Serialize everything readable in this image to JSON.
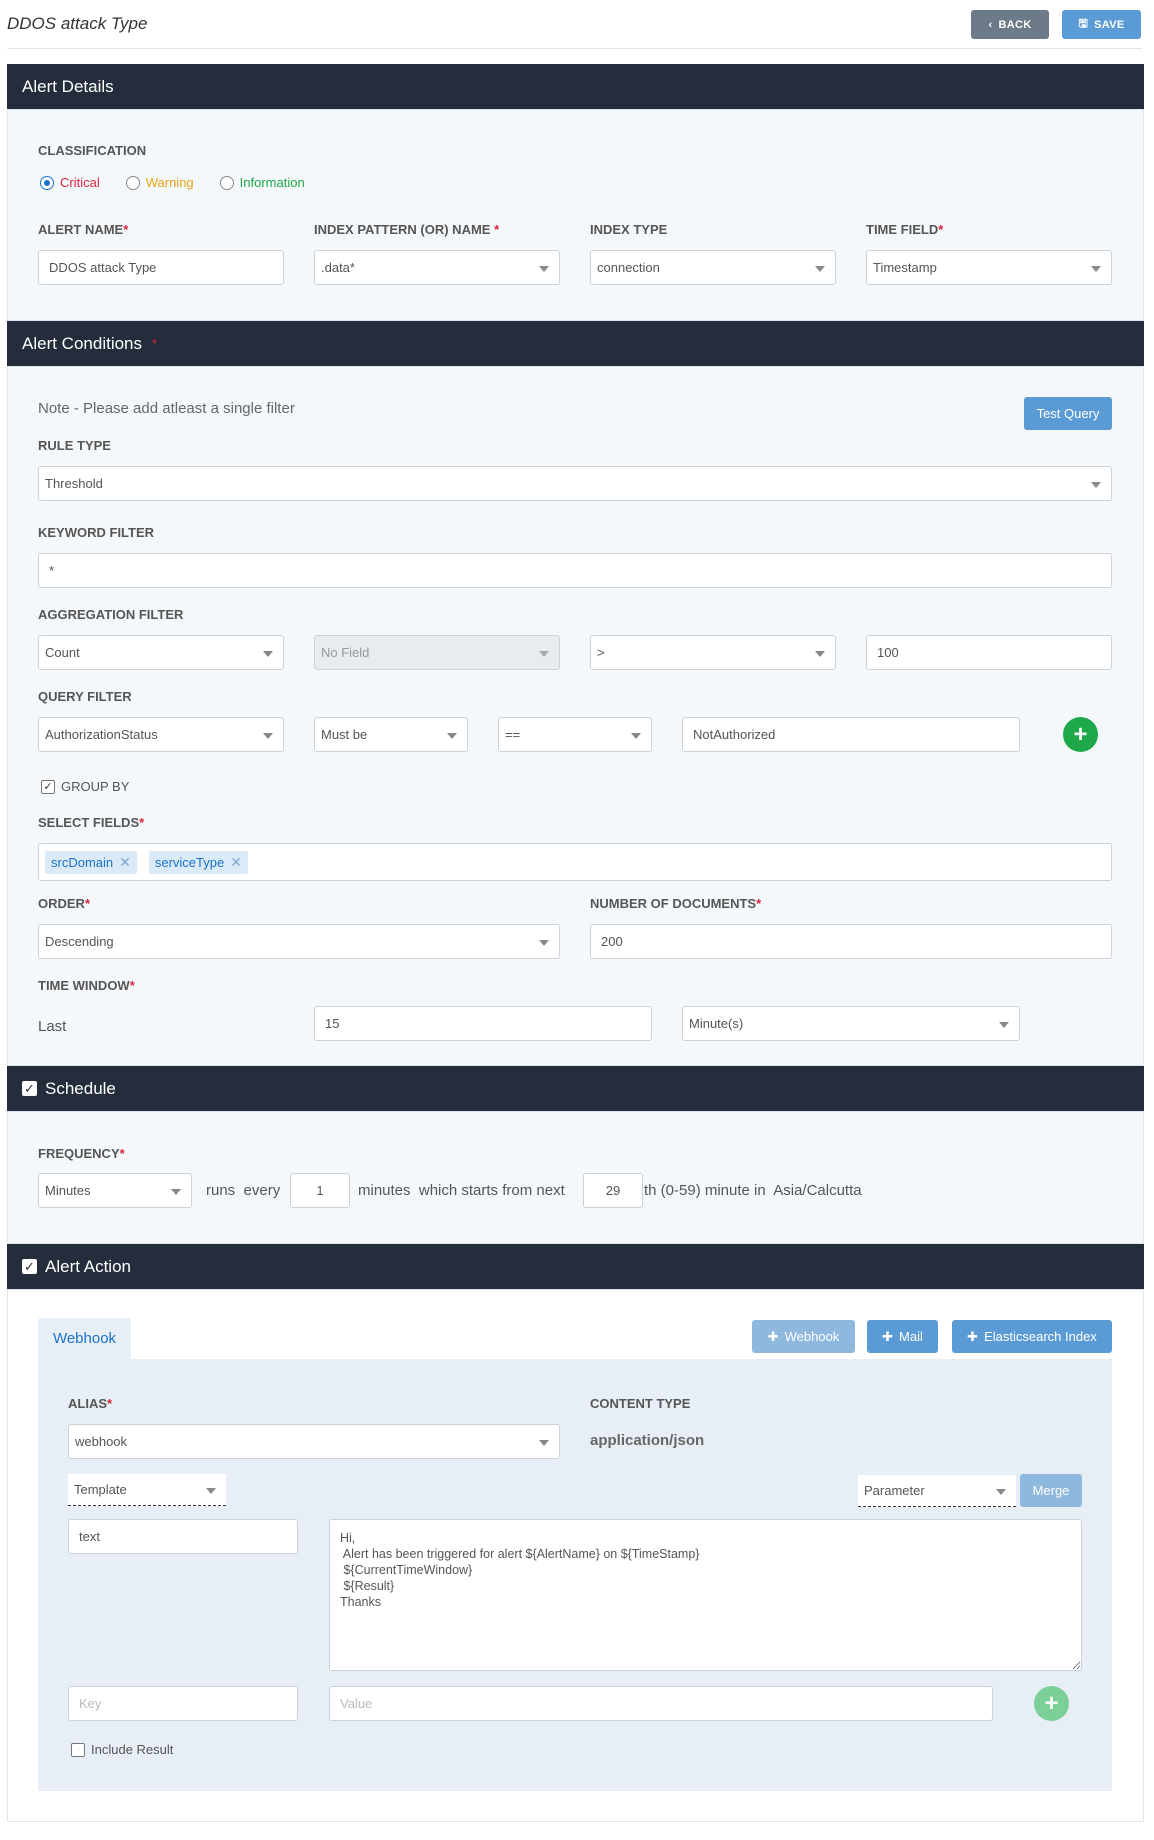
{
  "header": {
    "title": "DDOS attack Type",
    "back_label": "BACK",
    "save_label": "SAVE"
  },
  "alert_details": {
    "title": "Alert Details",
    "classification_label": "CLASSIFICATION",
    "classification_options": [
      {
        "label": "Critical",
        "color": "#d7263d",
        "selected": true
      },
      {
        "label": "Warning",
        "color": "#e8a317",
        "selected": false
      },
      {
        "label": "Information",
        "color": "#1fa84a",
        "selected": false
      }
    ],
    "alert_name_label": "ALERT NAME",
    "alert_name_value": "DDOS attack Type",
    "index_pattern_label": "INDEX PATTERN (OR) NAME",
    "index_pattern_value": ".data*",
    "index_type_label": "INDEX TYPE",
    "index_type_value": "connection",
    "time_field_label": "TIME FIELD",
    "time_field_value": "Timestamp"
  },
  "alert_conditions": {
    "title": "Alert Conditions",
    "note": "Note - Please add atleast a single filter",
    "test_query_label": "Test Query",
    "rule_type_label": "RULE TYPE",
    "rule_type_value": "Threshold",
    "keyword_filter_label": "KEYWORD FILTER",
    "keyword_filter_value": "*",
    "aggregation_filter_label": "AGGREGATION FILTER",
    "aggregation": {
      "function": "Count",
      "field": "No Field",
      "operator": ">",
      "value": "100"
    },
    "query_filter_label": "QUERY FILTER",
    "query_filter": {
      "field": "AuthorizationStatus",
      "condition": "Must be",
      "operator": "==",
      "value": "NotAuthorized"
    },
    "group_by_label": "GROUP BY",
    "select_fields_label": "SELECT FIELDS",
    "select_fields": [
      "srcDomain",
      "serviceType"
    ],
    "order_label": "ORDER",
    "order_value": "Descending",
    "num_docs_label": "NUMBER OF DOCUMENTS",
    "num_docs_value": "200",
    "time_window_label": "TIME WINDOW",
    "time_window_prefix": "Last",
    "time_window_value": "15",
    "time_window_unit": "Minute(s)"
  },
  "schedule": {
    "title": "Schedule",
    "frequency_label": "FREQUENCY",
    "frequency_value": "Minutes",
    "runs_every": "runs  every",
    "every_value": "1",
    "minutes_text": "minutes  which starts from next",
    "start_value": "29",
    "suffix_text": "th (0-59) minute in  Asia/Calcutta"
  },
  "alert_action": {
    "title": "Alert Action",
    "tab_label": "Webhook",
    "add_webhook_label": "Webhook",
    "add_mail_label": "Mail",
    "add_es_label": "Elasticsearch Index",
    "alias_label": "ALIAS",
    "alias_value": "webhook",
    "content_type_label": "CONTENT TYPE",
    "content_type_value": "application/json",
    "template_value": "Template",
    "parameter_value": "Parameter",
    "merge_label": "Merge",
    "text_value": "text",
    "message": "Hi,\n Alert has been triggered for alert ${AlertName} on ${TimeStamp}\n ${CurrentTimeWindow}\n ${Result}\nThanks",
    "key_placeholder": "Key",
    "value_placeholder": "Value",
    "include_result_label": "Include Result"
  },
  "colors": {
    "section_bar": "#252d3d",
    "accent": "#5b9bd5",
    "add_green": "#1fa84a",
    "required": "#d7263d"
  }
}
